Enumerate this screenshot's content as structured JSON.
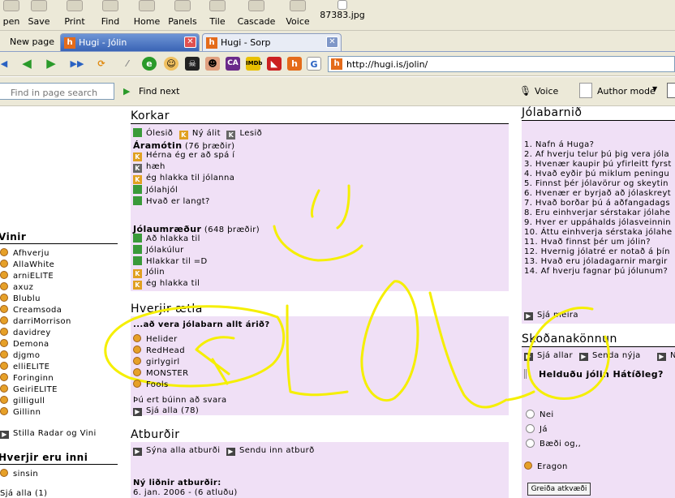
{
  "toolbar": {
    "buttons": [
      "pen",
      "Save",
      "Print",
      "Find",
      "Home",
      "Panels",
      "Tile",
      "Cascade",
      "Voice",
      "87383.jpg"
    ]
  },
  "tabs": {
    "new_page": "New page",
    "tab1": "Hugi - Jólin",
    "tab2": "Hugi - Sorp"
  },
  "address": {
    "url": "http://hugi.is/jolin/"
  },
  "findbar": {
    "placeholder": "Find in page search",
    "find_next": "Find next",
    "voice": "Voice",
    "author_mode": "Author mode"
  },
  "left": {
    "vinir_title": "Vinir",
    "vinir": [
      "Afhverju",
      "AllaWhite",
      "arniELITE",
      "axuz",
      "Blublu",
      "Creamsoda",
      "darriMorrison",
      "davidrey",
      "Demona",
      "djgmo",
      "elliELITE",
      "Foringinn",
      "GeiriELITE",
      "gilligull",
      "Gillinn"
    ],
    "stilla": "Stilla Radar og Vini",
    "inni_title": "Hverjir eru inni",
    "inni": [
      "sinsin"
    ],
    "sja_alla": "Sjá alla (1)"
  },
  "korkar": {
    "title": "Korkar",
    "legend": {
      "olesid": "Ólesið",
      "ny_alit": "Ný álit",
      "lesid": "Lesið"
    },
    "aramotin": {
      "title": "Áramótin",
      "count": "(76 þræðir)",
      "threads": [
        "Hérna ég er að spá í",
        "hæh",
        "ég hlakka til jólanna",
        "Jólahjól",
        "Hvað er langt?"
      ]
    },
    "jolaumraedur": {
      "title": "Jólaumræður",
      "count": "(648 þræðir)",
      "threads": [
        "Að hlakka til",
        "Jólakúlur",
        "Hlakkar til =D",
        "Jólin",
        "ég hlakka til"
      ]
    }
  },
  "hverjir": {
    "title": "Hverjir ætla",
    "question": "...að vera jólabarn allt árið?",
    "names": [
      "Hel​ider",
      "RedHead",
      "girlygirl",
      "MONSTER",
      "Fools"
    ],
    "answered": "Þú ert búinn að svara",
    "see_all": "Sjá alla (78)"
  },
  "atburdir": {
    "title": "Atburðir",
    "show_all": "Sýna alla atburði",
    "send_in": "Sendu inn atburð",
    "new_title": "Ný liðnir atburðir:",
    "first": "6. jan. 2006 - (6 atluðu)"
  },
  "jolabarnid": {
    "title": "Jólabarnið",
    "items": [
      "1. Nafn á Huga?",
      "2. Af hverju telur þú þig vera jóla",
      "3. Hvenær kaupir þú yfirleitt fyrst",
      "4. Hvað eyðir þú miklum peningu",
      "5. Finnst þér jólavörur og skeytin",
      "6. Hvenær er byrjað að jólaskreyt",
      "7. Hvað borðar þú á aðfangadags",
      "8. Eru einhverjar sérstakar jólahe",
      "9. Hver er uppáhalds jólasveinnin",
      "10. Áttu einhverja sérstaka jólahe",
      "11. Hvað finnst þér um jólin?",
      "12. Hvernig jólatré er notað á þín",
      "13. Hvað eru jóladagarnir margir",
      "14. Af hverju fagnar þú jólunum?"
    ],
    "more": "Sjá meira"
  },
  "skodana": {
    "title": "Skoðanakönnun",
    "see_all": "Sjá allar",
    "send": "Senda nýja",
    "n": "N",
    "question": "Helduðu jólin Hátíðleg?",
    "options": [
      "Nei",
      "Já",
      "Bæði og,,"
    ],
    "voter": "Eragon",
    "vote_button": "Greiða atkvæði"
  },
  "colors": {
    "highlight": "#f0e0f6",
    "scribble": "#f5ef00"
  }
}
